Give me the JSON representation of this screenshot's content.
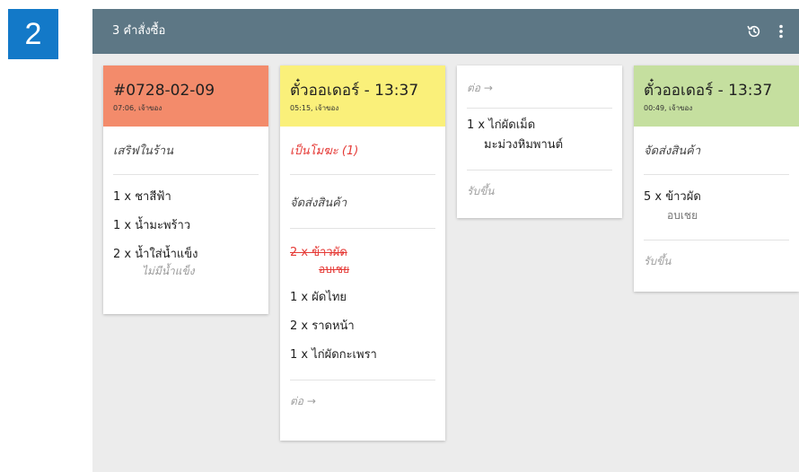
{
  "step_badge": "2",
  "topbar": {
    "title": "3 คำสั่งซื้อ",
    "history_icon": "history-icon",
    "menu_icon": "more-vert-icon"
  },
  "colors": {
    "topbar": "#5d7785",
    "card1_head": "#f38b6b",
    "card2_head": "#faf07a",
    "card4_head": "#c5df9f",
    "alert": "#e53935",
    "step_badge": "#1379c8"
  },
  "cards": [
    {
      "title": "#0728-02-09",
      "meta": "07:06, เจ้าของ",
      "sections": [
        {
          "label": "เสริฟในร้าน"
        },
        {
          "items": [
            {
              "qty_name": "1 x ชาสีฟ้า"
            },
            {
              "qty_name": "1 x น้ำมะพร้าว"
            },
            {
              "qty_name": "2 x น้ำใส่น้ำแข็ง",
              "note": "ไม่มีน้ำแข็ง"
            }
          ]
        }
      ]
    },
    {
      "title": "ตั๋วออเดอร์ - 13:37",
      "meta": "05:15, เจ้าของ",
      "sections": [
        {
          "label": "เป็นโมฆะ (1)"
        },
        {
          "label": "จัดส่งสินค้า"
        },
        {
          "items": [
            {
              "qty_name": "2 x ข้าวผัด",
              "note": "อบเชย"
            },
            {
              "qty_name": "1 x ผัดไทย"
            },
            {
              "qty_name": "2 x ราดหน้า"
            },
            {
              "qty_name": "1 x ไก่ผัดกะเพรา"
            }
          ]
        },
        {
          "label": "ต่อ →"
        }
      ]
    },
    {
      "sections": [
        {
          "label": "ต่อ →"
        },
        {
          "items": [
            {
              "qty_name": "1 x ไก่ผัดเม็ด",
              "note": "มะม่วงหิมพานต์"
            }
          ]
        },
        {
          "label": "รับขึ้น"
        }
      ]
    },
    {
      "title": "ตั๋วออเดอร์ - 13:37",
      "meta": "00:49, เจ้าของ",
      "sections": [
        {
          "label": "จัดส่งสินค้า"
        },
        {
          "items": [
            {
              "qty_name": "5 x ข้าวผัด",
              "note": "อบเชย"
            }
          ]
        },
        {
          "label": "รับขึ้น"
        }
      ]
    }
  ]
}
